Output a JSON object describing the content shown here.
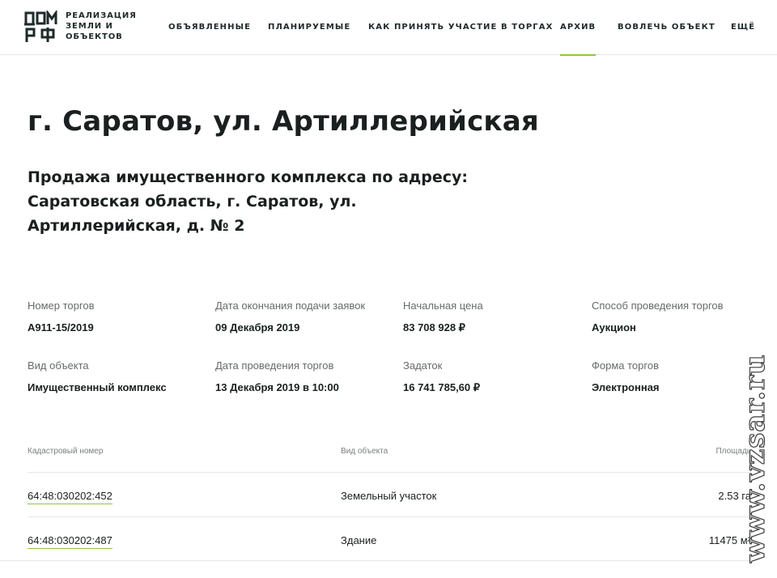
{
  "header": {
    "logo_lines": [
      "РЕАЛИЗАЦИЯ",
      "ЗЕМЛИ И",
      "ОБЪЕКТОВ"
    ],
    "nav": [
      {
        "label": "ОБЪЯВЛЕННЫЕ",
        "active": false
      },
      {
        "label": "ПЛАНИРУЕМЫЕ",
        "active": false
      },
      {
        "label": "КАК ПРИНЯТЬ УЧАСТИЕ В ТОРГАХ",
        "active": false
      },
      {
        "label": "АРХИВ",
        "active": true
      },
      {
        "label": "ВОВЛЕЧЬ ОБЪЕКТ",
        "active": false
      },
      {
        "label": "ЕЩЁ",
        "active": false
      }
    ]
  },
  "page": {
    "title": "г. Саратов, ул. Артиллерийская",
    "subtitle": "Продажа имущественного комплекса по адресу: Саратовская область, г. Саратов, ул. Артиллерийская, д. № 2"
  },
  "info": {
    "lot_number": {
      "label": "Номер торгов",
      "value": "А911-15/2019"
    },
    "deadline": {
      "label": "Дата окончания подачи заявок",
      "value": "09 Декабря 2019"
    },
    "start_price": {
      "label": "Начальная цена",
      "value": "83 708 928 ₽"
    },
    "method": {
      "label": "Способ проведения торгов",
      "value": "Аукцион"
    },
    "object_type": {
      "label": "Вид объекта",
      "value": "Имущественный комплекс"
    },
    "auction_date": {
      "label": "Дата проведения торгов",
      "value": "13 Декабря 2019 в 10:00"
    },
    "deposit": {
      "label": "Задаток",
      "value": "16 741 785,60 ₽"
    },
    "form": {
      "label": "Форма торгов",
      "value": "Электронная"
    }
  },
  "table": {
    "headers": {
      "cadastral": "Кадастровый номер",
      "type": "Вид объекта",
      "area": "Площадь"
    },
    "rows": [
      {
        "cadastral": "64:48:030202:452",
        "type": "Земельный участок",
        "area": "2.53 га"
      },
      {
        "cadastral": "64:48:030202:487",
        "type": "Здание",
        "area": "11475 м²"
      }
    ]
  },
  "watermark": {
    "text": "www.vzsar.ru"
  },
  "colors": {
    "accent": "#8dc63f",
    "text": "#1a1f1f",
    "muted": "#666b6b",
    "divider": "#e6e6e6"
  }
}
